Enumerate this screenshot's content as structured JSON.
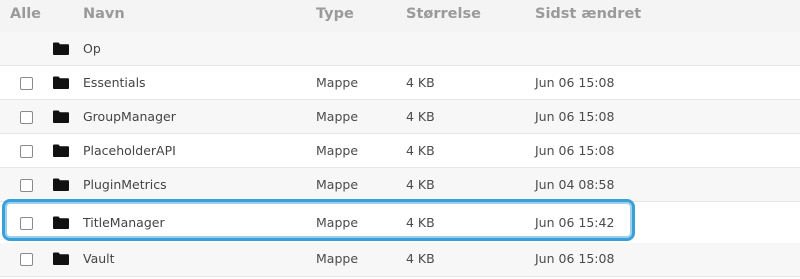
{
  "header": {
    "select_all": "Alle",
    "name": "Navn",
    "type": "Type",
    "size": "Størrelse",
    "modified": "Sidst ændret"
  },
  "rows": [
    {
      "name": "Op",
      "type": "",
      "size": "",
      "modified": "",
      "has_checkbox": false,
      "icon": "folder-icon"
    },
    {
      "name": "Essentials",
      "type": "Mappe",
      "size": "4 KB",
      "modified": "Jun 06 15:08",
      "has_checkbox": true,
      "icon": "folder-icon"
    },
    {
      "name": "GroupManager",
      "type": "Mappe",
      "size": "4 KB",
      "modified": "Jun 06 15:08",
      "has_checkbox": true,
      "icon": "folder-icon"
    },
    {
      "name": "PlaceholderAPI",
      "type": "Mappe",
      "size": "4 KB",
      "modified": "Jun 06 15:08",
      "has_checkbox": true,
      "icon": "folder-icon"
    },
    {
      "name": "PluginMetrics",
      "type": "Mappe",
      "size": "4 KB",
      "modified": "Jun 04 08:58",
      "has_checkbox": true,
      "icon": "folder-icon"
    },
    {
      "name": "TitleManager",
      "type": "Mappe",
      "size": "4 KB",
      "modified": "Jun 06 15:42",
      "has_checkbox": true,
      "icon": "folder-icon",
      "highlighted": true
    },
    {
      "name": "Vault",
      "type": "Mappe",
      "size": "4 KB",
      "modified": "Jun 06 15:08",
      "has_checkbox": true,
      "icon": "folder-icon"
    }
  ],
  "colors": {
    "highlight": "#3aa0d8"
  }
}
